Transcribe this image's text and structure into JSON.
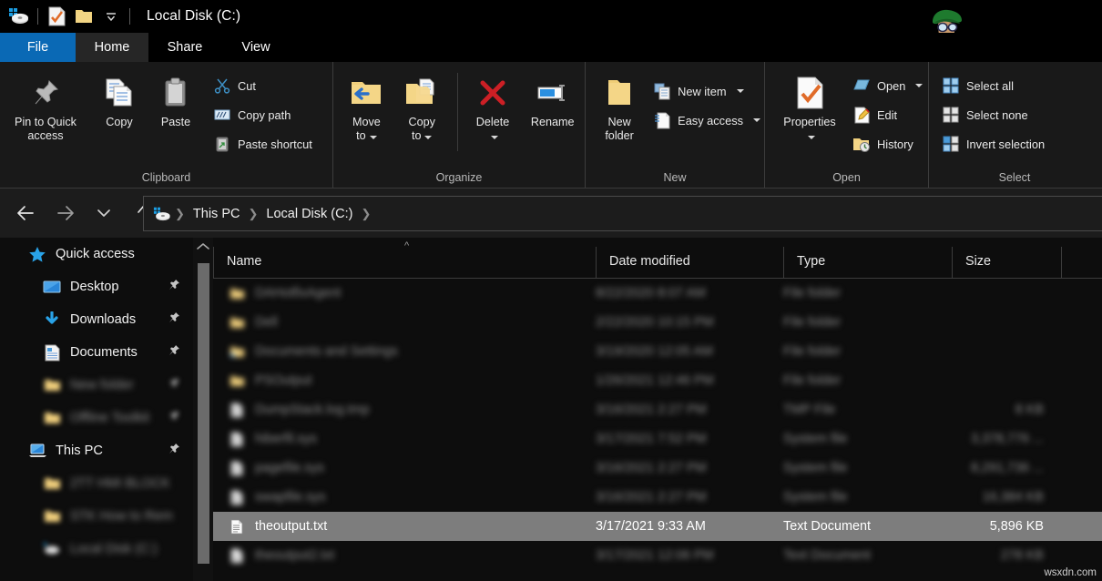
{
  "window": {
    "title": "Local Disk (C:)",
    "quick_access_toolbar": [
      {
        "name": "drive-icon",
        "label": "Local Disk"
      },
      {
        "name": "properties-icon",
        "label": "Properties"
      },
      {
        "name": "new-folder-icon",
        "label": "New folder"
      },
      {
        "name": "chevron-down-icon",
        "label": "Customize Quick Access Toolbar"
      }
    ],
    "mascot_alt": "cartoon-avatar"
  },
  "tabs": [
    {
      "id": "file",
      "label": "File",
      "active": false,
      "accent": "#0a69b5"
    },
    {
      "id": "home",
      "label": "Home",
      "active": true
    },
    {
      "id": "share",
      "label": "Share",
      "active": false
    },
    {
      "id": "view",
      "label": "View",
      "active": false
    }
  ],
  "ribbon": {
    "groups": [
      {
        "id": "clipboard",
        "label": "Clipboard",
        "big_buttons": [
          {
            "id": "pin-to-quick-access",
            "label": "Pin to Quick\naccess",
            "icon": "pin-icon"
          },
          {
            "id": "copy",
            "label": "Copy",
            "icon": "copy-icon"
          },
          {
            "id": "paste",
            "label": "Paste",
            "icon": "paste-icon"
          }
        ],
        "small_buttons": [
          {
            "id": "cut",
            "label": "Cut",
            "icon": "scissors-icon"
          },
          {
            "id": "copy-path",
            "label": "Copy path",
            "icon": "copy-path-icon"
          },
          {
            "id": "paste-shortcut",
            "label": "Paste shortcut",
            "icon": "paste-shortcut-icon"
          }
        ]
      },
      {
        "id": "organize",
        "label": "Organize",
        "big_buttons": [
          {
            "id": "move-to",
            "label": "Move\nto",
            "icon": "move-to-icon",
            "has_caret": true
          },
          {
            "id": "copy-to",
            "label": "Copy\nto",
            "icon": "copy-to-icon",
            "has_caret": true
          },
          {
            "id": "delete",
            "label": "Delete",
            "icon": "delete-icon",
            "has_caret": true
          },
          {
            "id": "rename",
            "label": "Rename",
            "icon": "rename-icon"
          }
        ]
      },
      {
        "id": "new",
        "label": "New",
        "big_buttons": [
          {
            "id": "new-folder",
            "label": "New\nfolder",
            "icon": "new-folder-icon"
          }
        ],
        "small_buttons": [
          {
            "id": "new-item",
            "label": "New item",
            "icon": "new-item-icon",
            "has_caret": true
          },
          {
            "id": "easy-access",
            "label": "Easy access",
            "icon": "easy-access-icon",
            "has_caret": true
          }
        ]
      },
      {
        "id": "open",
        "label": "Open",
        "big_buttons": [
          {
            "id": "properties",
            "label": "Properties",
            "icon": "properties-icon",
            "has_caret": true
          }
        ],
        "small_buttons": [
          {
            "id": "open",
            "label": "Open",
            "icon": "open-icon",
            "has_caret": true
          },
          {
            "id": "edit",
            "label": "Edit",
            "icon": "edit-icon"
          },
          {
            "id": "history",
            "label": "History",
            "icon": "history-icon"
          }
        ]
      },
      {
        "id": "select",
        "label": "Select",
        "small_buttons": [
          {
            "id": "select-all",
            "label": "Select all",
            "icon": "select-all-icon"
          },
          {
            "id": "select-none",
            "label": "Select none",
            "icon": "select-none-icon"
          },
          {
            "id": "invert-selection",
            "label": "Invert selection",
            "icon": "invert-selection-icon"
          }
        ]
      }
    ]
  },
  "navigation": {
    "back": "Back",
    "forward": "Forward",
    "recent": "Recent locations",
    "up": "Up one level",
    "breadcrumbs": [
      {
        "label": "This PC"
      },
      {
        "label": "Local Disk (C:)"
      }
    ]
  },
  "sidebar": {
    "items": [
      {
        "id": "quick-access",
        "label": "Quick access",
        "icon": "star-icon",
        "indent": false,
        "pinned": false,
        "blurred": false
      },
      {
        "id": "desktop",
        "label": "Desktop",
        "icon": "desktop-icon",
        "indent": true,
        "pinned": true,
        "blurred": false
      },
      {
        "id": "downloads",
        "label": "Downloads",
        "icon": "download-icon",
        "indent": true,
        "pinned": true,
        "blurred": false
      },
      {
        "id": "documents",
        "label": "Documents",
        "icon": "documents-icon",
        "indent": true,
        "pinned": true,
        "blurred": false
      },
      {
        "id": "redacted-folder-1",
        "label": "New folder",
        "icon": "folder-icon",
        "indent": true,
        "pinned": true,
        "blurred": true
      },
      {
        "id": "redacted-folder-2",
        "label": "Offline Toolkit",
        "icon": "folder-icon",
        "indent": true,
        "pinned": true,
        "blurred": true
      },
      {
        "id": "this-pc",
        "label": "This PC",
        "icon": "pc-icon",
        "indent": false,
        "pinned": true,
        "blurred": false
      },
      {
        "id": "redacted-folder-3",
        "label": "2TT HMI BLOCK",
        "icon": "folder-icon",
        "indent": true,
        "pinned": false,
        "blurred": true
      },
      {
        "id": "redacted-folder-4",
        "label": "STK How to Rem",
        "icon": "folder-icon",
        "indent": true,
        "pinned": false,
        "blurred": true
      },
      {
        "id": "redacted-drive-1",
        "label": "Local Disk (C:)",
        "icon": "drive-icon",
        "indent": true,
        "pinned": false,
        "blurred": true
      }
    ]
  },
  "file_list": {
    "columns": [
      {
        "id": "name",
        "label": "Name",
        "sorted": "asc"
      },
      {
        "id": "date-modified",
        "label": "Date modified"
      },
      {
        "id": "type",
        "label": "Type"
      },
      {
        "id": "size",
        "label": "Size"
      }
    ],
    "rows": [
      {
        "name": "DAHotfixAgent",
        "date": "8/22/2020 8:07 AM",
        "type": "File folder",
        "size": "",
        "icon": "folder-icon",
        "selected": false,
        "blurred": true
      },
      {
        "name": "Dell",
        "date": "2/22/2020 10:15 PM",
        "type": "File folder",
        "size": "",
        "icon": "folder-icon",
        "selected": false,
        "blurred": true
      },
      {
        "name": "Documents and Settings",
        "date": "3/19/2020 12:05 AM",
        "type": "File folder",
        "size": "",
        "icon": "folder-shortcut-icon",
        "selected": false,
        "blurred": true
      },
      {
        "name": "PSOutput",
        "date": "1/26/2021 12:46 PM",
        "type": "File folder",
        "size": "",
        "icon": "folder-icon",
        "selected": false,
        "blurred": true
      },
      {
        "name": "DumpStack.log.tmp",
        "date": "3/16/2021 2:27 PM",
        "type": "TMP File",
        "size": "8 KB",
        "icon": "file-icon",
        "selected": false,
        "blurred": true
      },
      {
        "name": "hiberfil.sys",
        "date": "3/17/2021 7:52 PM",
        "type": "System file",
        "size": "3,378,776 ...",
        "icon": "file-icon",
        "selected": false,
        "blurred": true
      },
      {
        "name": "pagefile.sys",
        "date": "3/16/2021 2:27 PM",
        "type": "System file",
        "size": "8,291,736 ...",
        "icon": "file-icon",
        "selected": false,
        "blurred": true
      },
      {
        "name": "swapfile.sys",
        "date": "3/16/2021 2:27 PM",
        "type": "System file",
        "size": "16,384 KB",
        "icon": "file-icon",
        "selected": false,
        "blurred": true
      },
      {
        "name": "theoutput.txt",
        "date": "3/17/2021 9:33 AM",
        "type": "Text Document",
        "size": "5,896 KB",
        "icon": "text-file-icon",
        "selected": true,
        "blurred": false
      },
      {
        "name": "theoutput2.txt",
        "date": "3/17/2021 12:06 PM",
        "type": "Text Document",
        "size": "278 KB",
        "icon": "text-file-icon",
        "selected": false,
        "blurred": true
      }
    ]
  },
  "watermark": "wsxdn.com"
}
